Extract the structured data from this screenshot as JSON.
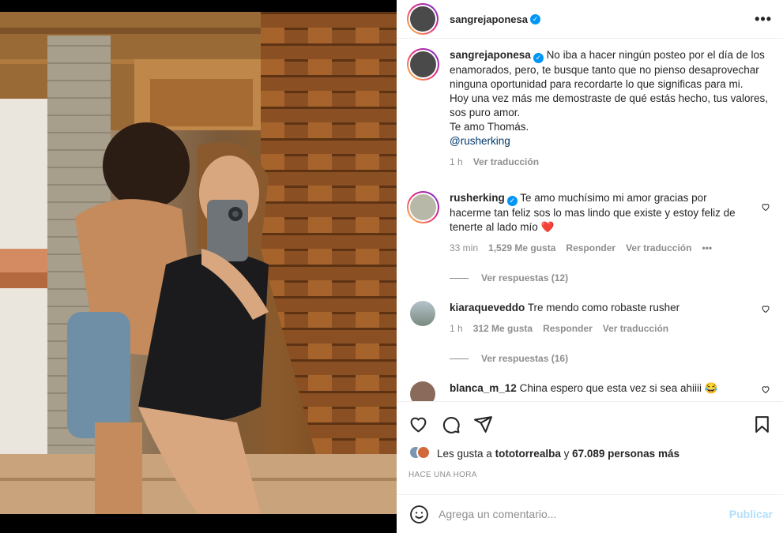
{
  "post": {
    "author": "sangrejaponesa",
    "caption": {
      "line1": "No iba a hacer ningún posteo por el día de los enamorados, pero, te busque tanto que no pienso desaprovechar ninguna oportunidad para recordarte lo que significas para mi.",
      "line2": "Hoy una vez más me demostraste de qué estás hecho, tus valores, sos puro amor.",
      "line3": "Te amo Thomás.",
      "mention": "@rusherking",
      "time": "1 h",
      "translate": "Ver traducción"
    }
  },
  "comments": [
    {
      "user": "rusherking",
      "verified": true,
      "text": "Te amo muchísimo mi amor gracias por hacerme tan feliz sos lo mas lindo que existe y estoy feliz de tenerte al lado mío ❤️",
      "time": "33 min",
      "likes": "1,529 Me gusta",
      "reply": "Responder",
      "translate": "Ver traducción",
      "more": "•••",
      "replies": "Ver respuestas (12)"
    },
    {
      "user": "kiaraqueveddo",
      "verified": false,
      "text": "Tre mendo como robaste rusher",
      "time": "1 h",
      "likes": "312 Me gusta",
      "reply": "Responder",
      "translate": "Ver traducción",
      "replies": "Ver respuestas (16)"
    },
    {
      "user": "blanca_m_12",
      "text": "China espero que esta vez si sea ahiiii 😂"
    }
  ],
  "likes_bar": {
    "prefix": "Les gusta a",
    "user": "tototorrealba",
    "middle": "y",
    "count": "67.089 personas más"
  },
  "timestamp_label": "HACE UNA HORA",
  "add_comment": {
    "placeholder": "Agrega un comentario...",
    "publish": "Publicar"
  },
  "colors": {
    "accent": "#0095f6",
    "link": "#00376b",
    "muted": "#8e8e8e",
    "publish_disabled": "#b2dffc",
    "heart_emoji": "#e0245e"
  }
}
